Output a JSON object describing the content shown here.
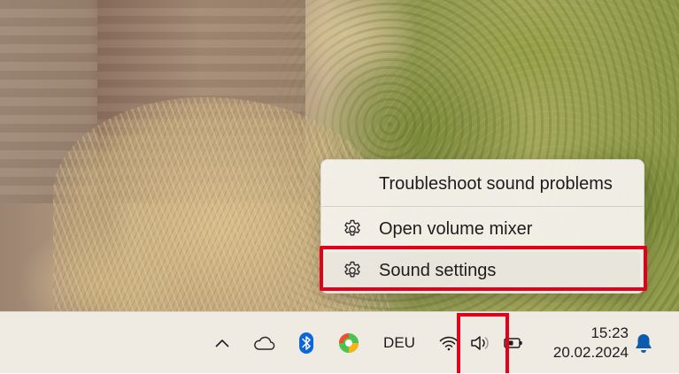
{
  "context_menu": {
    "items": [
      {
        "label": "Troubleshoot sound problems",
        "icon": null
      },
      {
        "label": "Open volume mixer",
        "icon": "gear-icon"
      },
      {
        "label": "Sound settings",
        "icon": "gear-icon",
        "highlighted": true
      }
    ]
  },
  "taskbar": {
    "tray_icons": [
      "show-hidden-icons-chevron-icon",
      "onedrive-cloud-icon",
      "bluetooth-icon",
      "edge-browser-icon",
      "wifi-icon",
      "volume-speaker-icon",
      "battery-icon",
      "notification-bell-icon"
    ],
    "language": "DEU",
    "time": "15:23",
    "date": "20.02.2024"
  },
  "colors": {
    "highlight": "#e3001b",
    "taskbar_bg": "#efebe2",
    "menu_bg": "#f4f1e9",
    "bluetooth_blue": "#0a66d9",
    "bell_blue": "#0b5cad"
  }
}
